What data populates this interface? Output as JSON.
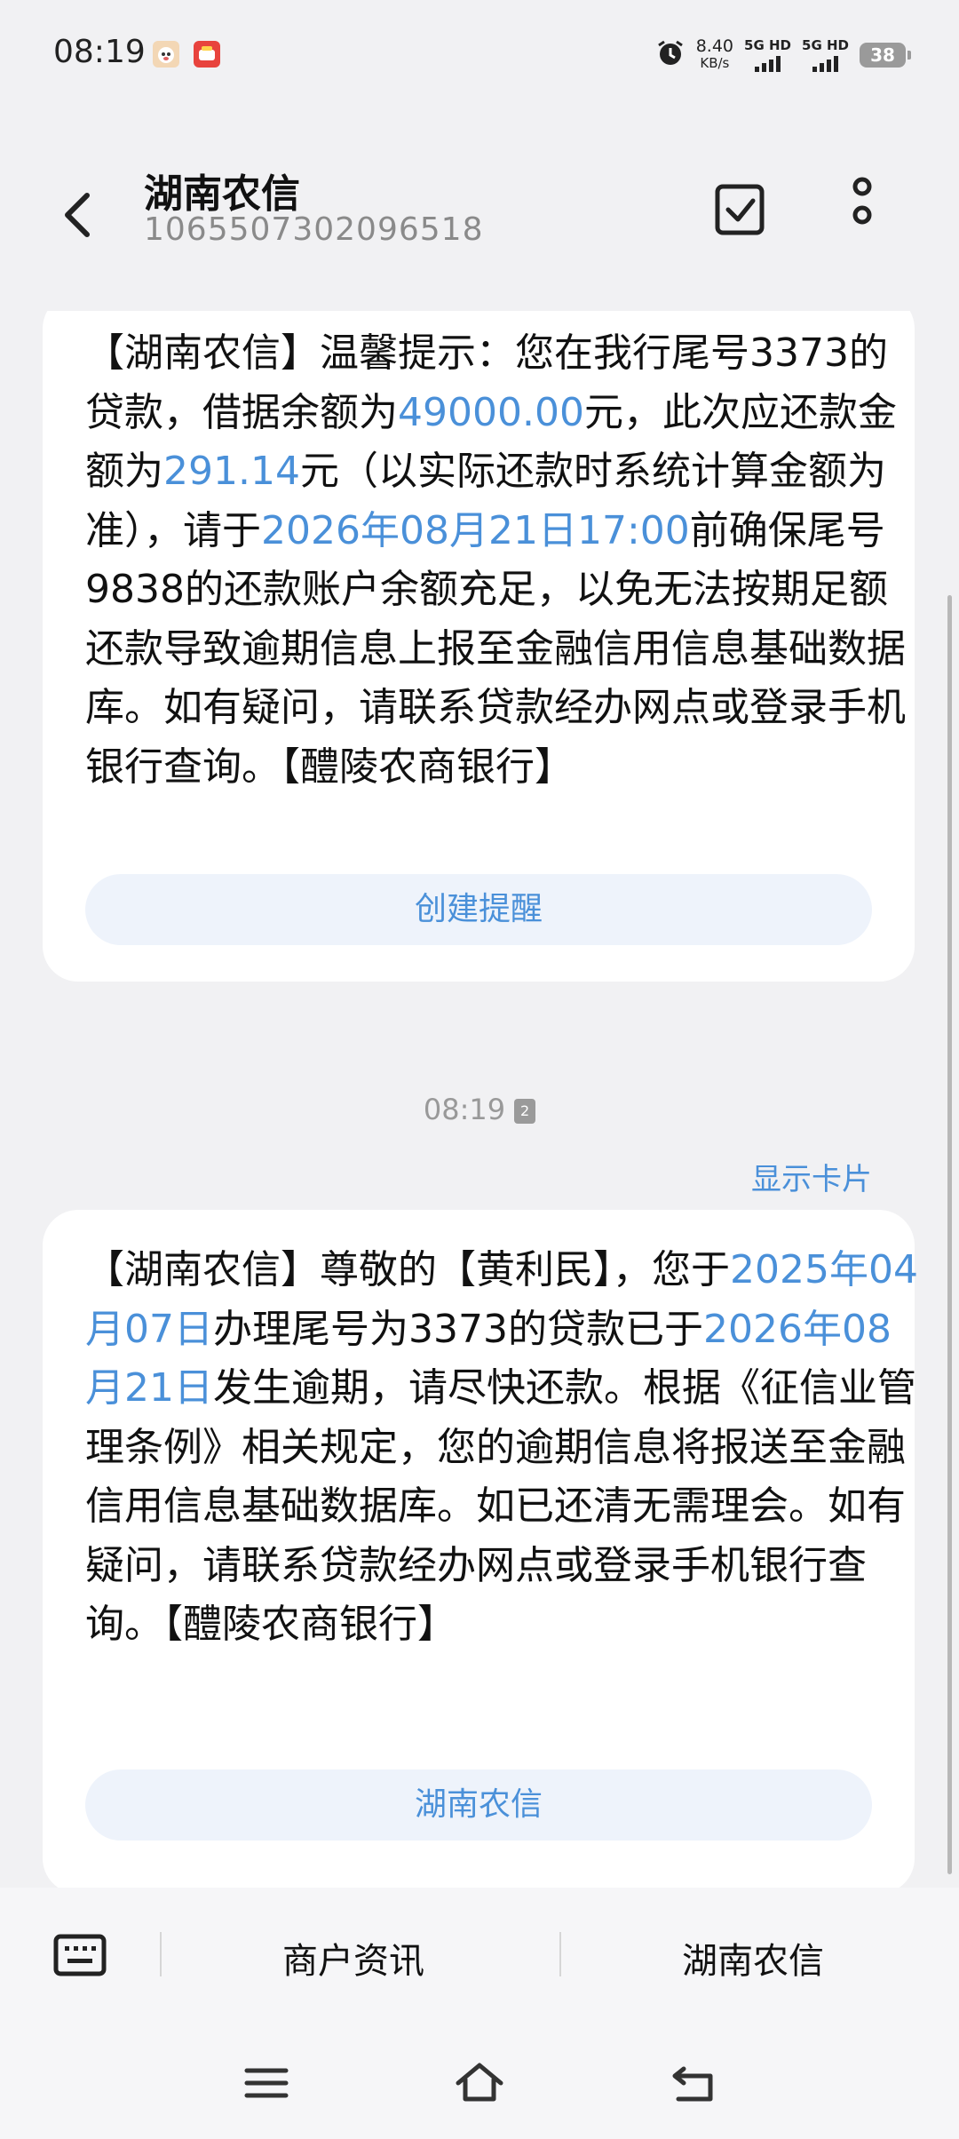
{
  "status_bar": {
    "time": "08:19",
    "net_speed_value": "8.40",
    "net_speed_unit": "KB/s",
    "sim1_label": "5G HD",
    "sim2_label": "5G HD",
    "battery": "38"
  },
  "header": {
    "title": "湖南农信",
    "number": "1065507302096518"
  },
  "messages": [
    {
      "segments": [
        {
          "text": "【湖南农信】温馨提示：您在我行尾号3373的贷款，借据余额为",
          "hl": false
        },
        {
          "text": "49000.00",
          "hl": true
        },
        {
          "text": "元，此次应还款金额为",
          "hl": false
        },
        {
          "text": "291.14",
          "hl": true
        },
        {
          "text": "元（以实际还款时系统计算金额为准），请于",
          "hl": false
        },
        {
          "text": "2026年08月21日17:00",
          "hl": true
        },
        {
          "text": "前确保尾号9838的还款账户余额充足，以免无法按期足额还款导致逾期信息上报至金融信用信息基础数据库。如有疑问，请联系贷款经办网点或登录手机银行查询。【醴陵农商银行】",
          "hl": false
        }
      ],
      "action_label": "创建提醒"
    },
    {
      "segments": [
        {
          "text": "【湖南农信】尊敬的【黄利民】，您于",
          "hl": false
        },
        {
          "text": "2025年04月07日",
          "hl": true
        },
        {
          "text": "办理尾号为3373的贷款已于",
          "hl": false
        },
        {
          "text": "2026年08月21日",
          "hl": true
        },
        {
          "text": "发生逾期，请尽快还款。根据《征信业管理条例》相关规定，您的逾期信息将报送至金融信用信息基础数据库。如已还清无需理会。如有疑问，请联系贷款经办网点或登录手机银行查询。【醴陵农商银行】",
          "hl": false
        }
      ],
      "action_label": "湖南农信"
    }
  ],
  "timestamp": {
    "time": "08:19",
    "sim": "2"
  },
  "show_card_label": "显示卡片",
  "bottom_menu": {
    "item1": "商户资讯",
    "item2": "湖南农信"
  },
  "colors": {
    "accent": "#4a90d9",
    "background": "#f1f1f3",
    "card": "#ffffff"
  },
  "icons": {
    "back": "back-arrow-icon",
    "select": "checkbox-icon",
    "more": "more-vertical-icon",
    "keyboard": "keyboard-icon",
    "nav_menu": "menu-icon",
    "nav_home": "home-icon",
    "nav_back": "back-icon"
  }
}
